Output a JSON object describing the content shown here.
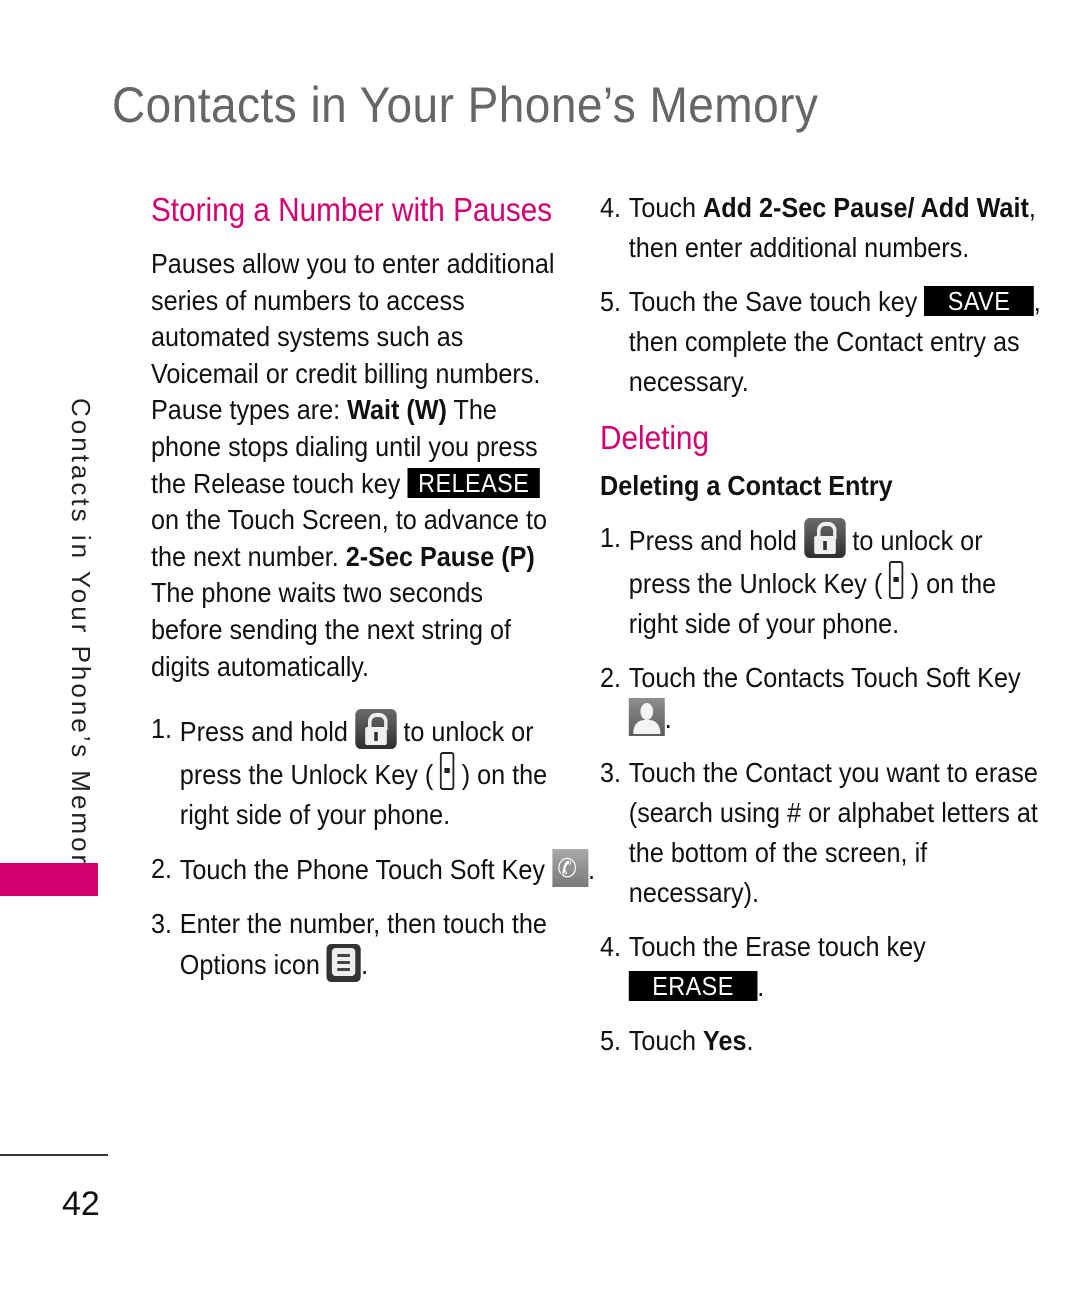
{
  "page": {
    "title": "Contacts in Your Phone’s Memory",
    "side_tab": "Contacts in Your Phone’s Memory",
    "page_number": "42",
    "accent_color": "#d4006f"
  },
  "left": {
    "heading": "Storing a Number with Pauses",
    "intro": {
      "t1": "Pauses allow you to enter additional series of numbers to access automated systems such as Voicemail or credit billing numbers. Pause types are: ",
      "b1": "Wait (W)",
      "t2": " The phone stops dialing until you press the Release touch key ",
      "release_key": "RELEASE",
      "t3": " on the Touch Screen, to advance to the next number. ",
      "b2": "2-Sec Pause (P)",
      "t4": " The phone waits two seconds before sending the next string of digits automatically."
    },
    "steps": [
      {
        "num": "1.",
        "t1": "Press and hold ",
        "icon": "lock-icon",
        "t2": " to unlock or press the Unlock Key ( ",
        "icon2": "unlock-key-icon",
        "t3": " ) on the right side of your phone."
      },
      {
        "num": "2.",
        "t1": "Touch the Phone Touch Soft Key ",
        "icon": "phone-icon",
        "t2": "."
      },
      {
        "num": "3.",
        "t1": "Enter the number, then touch the Options icon ",
        "icon": "options-icon",
        "t2": "."
      }
    ]
  },
  "right": {
    "steps_continued": [
      {
        "num": "4.",
        "t1": "Touch ",
        "b1": "Add 2-Sec Pause/ Add Wait",
        "t2": ", then enter additional numbers."
      },
      {
        "num": "5.",
        "t1": "Touch the Save touch key ",
        "key": "SAVE",
        "t2": ", then complete the Contact entry as necessary."
      }
    ],
    "heading": "Deleting",
    "subheading": "Deleting a Contact Entry",
    "steps": [
      {
        "num": "1.",
        "t1": "Press and hold ",
        "icon": "lock-icon",
        "t2": " to unlock or press the Unlock Key ( ",
        "icon2": "unlock-key-icon",
        "t3": " ) on the right side of your phone."
      },
      {
        "num": "2.",
        "t1": "Touch the Contacts Touch Soft Key ",
        "icon": "contacts-icon",
        "t2": "."
      },
      {
        "num": "3.",
        "t1": "Touch the Contact you want to erase (search using # or alphabet letters at the bottom of the screen, if necessary)."
      },
      {
        "num": "4.",
        "t1": "Touch the Erase touch key ",
        "key": "ERASE",
        "t2": "."
      },
      {
        "num": "5.",
        "t1": "Touch ",
        "b1": "Yes",
        "t2": "."
      }
    ]
  }
}
